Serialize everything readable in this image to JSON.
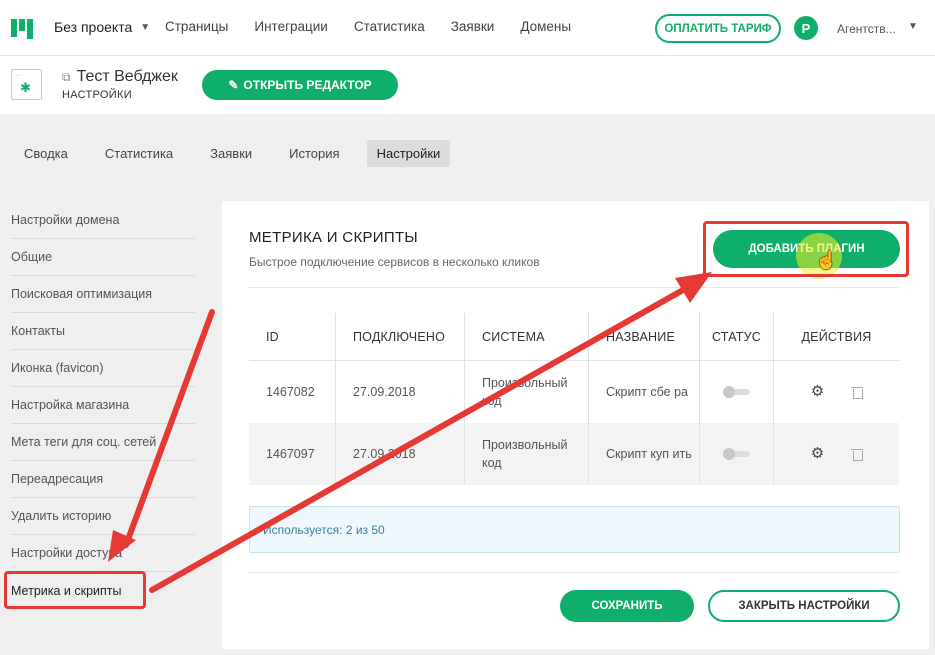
{
  "topbar": {
    "project": "Без проекта",
    "nav": [
      "Страницы",
      "Интеграции",
      "Статистика",
      "Заявки",
      "Домены"
    ],
    "pay_label": "ОПЛАТИТЬ ТАРИФ",
    "avatar_letter": "P",
    "account": "Агентств..."
  },
  "site": {
    "title": "Тест Вебджек",
    "subtitle": "НАСТРОЙКИ",
    "open_editor": "ОТКРЫТЬ РЕДАКТОР"
  },
  "tabs": [
    {
      "label": "Сводка",
      "active": false
    },
    {
      "label": "Статистика",
      "active": false
    },
    {
      "label": "Заявки",
      "active": false
    },
    {
      "label": "История",
      "active": false
    },
    {
      "label": "Настройки",
      "active": true
    }
  ],
  "sidebar": {
    "items": [
      "Настройки домена",
      "Общие",
      "Поисковая оптимизация",
      "Контакты",
      "Иконка (favicon)",
      "Настройка магазина",
      "Мета теги для соц. сетей",
      "Переадресация",
      "Удалить историю",
      "Настройки доступа",
      "Метрика и скрипты"
    ],
    "active_index": 10
  },
  "panel": {
    "title": "МЕТРИКА И СКРИПТЫ",
    "subtitle": "Быстрое подключение сервисов в несколько кликов",
    "add_plugin": "ДОБАВИТЬ ПЛАГИН",
    "columns": [
      "ID",
      "ПОДКЛЮЧЕНО",
      "СИСТЕМА",
      "НАЗВАНИЕ",
      "СТАТУС",
      "ДЕЙСТВИЯ"
    ],
    "rows": [
      {
        "id": "1467082",
        "date": "27.09.2018",
        "system": "Произвольный код",
        "name": "Скрипт сбе ра",
        "status": "off"
      },
      {
        "id": "1467097",
        "date": "27.09.2018",
        "system": "Произвольный код",
        "name": "Скрипт куп ить",
        "status": "off"
      }
    ],
    "usage": "Используется: 2 из 50",
    "save": "СОХРАНИТЬ",
    "close": "ЗАКРЫТЬ НАСТРОЙКИ"
  },
  "colors": {
    "accent": "#0fae6a",
    "annotation": "#e53935"
  }
}
